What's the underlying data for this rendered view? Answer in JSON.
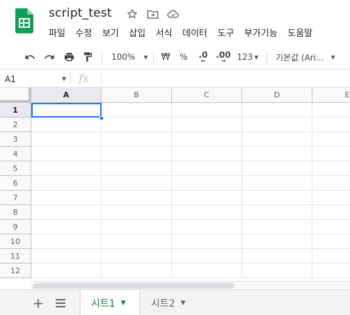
{
  "document": {
    "title": "script_test"
  },
  "menu": [
    "파일",
    "수정",
    "보기",
    "삽입",
    "서식",
    "데이터",
    "도구",
    "부가기능",
    "도움말"
  ],
  "toolbar": {
    "zoom": "100%",
    "currency": "₩",
    "percent": "%",
    "decrease_decimal": ".0",
    "increase_decimal": ".00",
    "more_formats": "123",
    "font": "기본값 (Ari..."
  },
  "formula_bar": {
    "cell_ref": "A1",
    "fx": "fx",
    "value": ""
  },
  "grid": {
    "columns": [
      "A",
      "B",
      "C",
      "D",
      "E"
    ],
    "rows": [
      "1",
      "2",
      "3",
      "4",
      "5",
      "6",
      "7",
      "8",
      "9",
      "10",
      "11",
      "12"
    ],
    "selected_cell": "A1"
  },
  "sheets": [
    {
      "label": "시트1",
      "active": true
    },
    {
      "label": "시트2",
      "active": false
    }
  ],
  "colors": {
    "accent": "#1a73e8",
    "sheets_green": "#0f9d58",
    "active_tab_text": "#188038"
  }
}
